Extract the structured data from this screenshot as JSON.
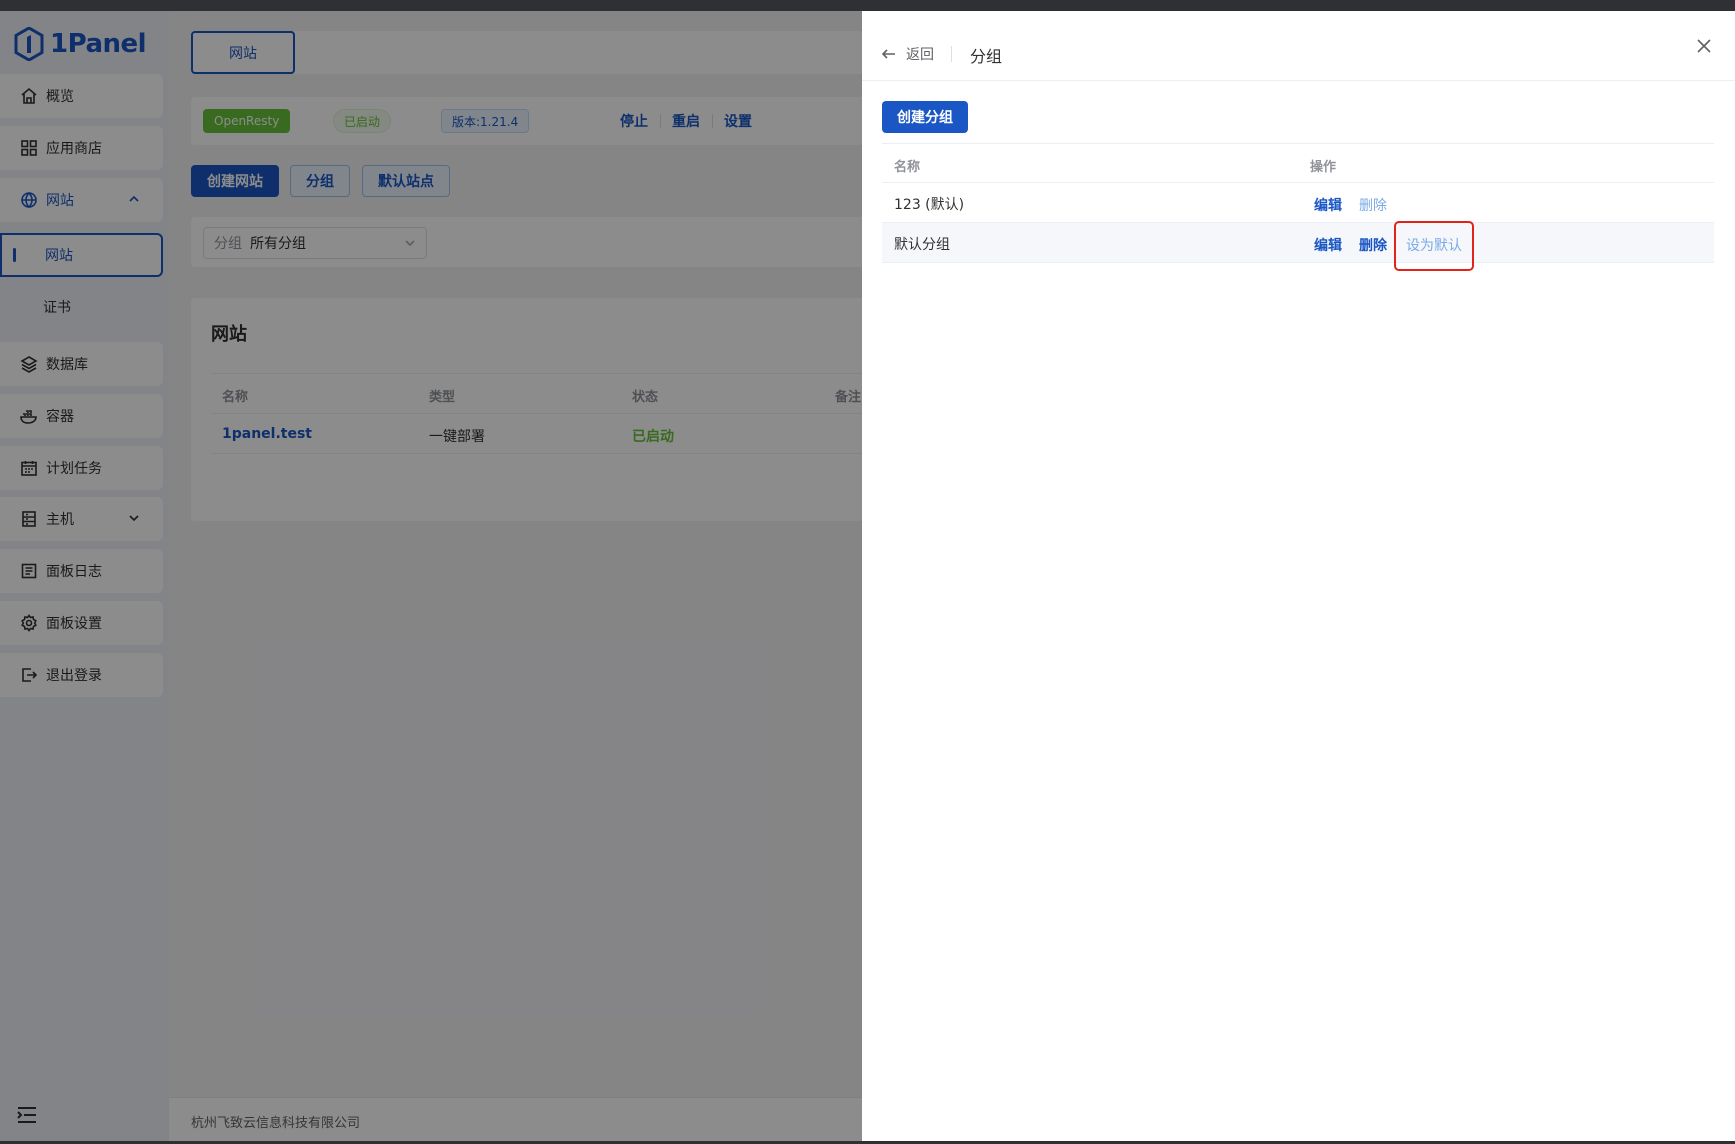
{
  "app": {
    "logo_text": "1Panel",
    "brand_color": "#1a56c4"
  },
  "sidebar": {
    "items": [
      {
        "label": "概览",
        "icon": "home-icon"
      },
      {
        "label": "应用商店",
        "icon": "grid-icon"
      },
      {
        "label": "网站",
        "icon": "globe-icon"
      },
      {
        "label": "数据库",
        "icon": "layers-icon"
      },
      {
        "label": "容器",
        "icon": "docker-icon"
      },
      {
        "label": "计划任务",
        "icon": "calendar-icon"
      },
      {
        "label": "主机",
        "icon": "server-icon"
      },
      {
        "label": "面板日志",
        "icon": "log-icon"
      },
      {
        "label": "面板设置",
        "icon": "gear-icon"
      },
      {
        "label": "退出登录",
        "icon": "logout-icon"
      }
    ],
    "subitems": [
      {
        "label": "网站",
        "active": true
      },
      {
        "label": "证书",
        "active": false
      }
    ]
  },
  "main": {
    "tab": "网站",
    "app_bar": {
      "app_tag": "OpenResty",
      "status_tag": "已启动",
      "version_tag": "版本:1.21.4",
      "actions": [
        "停止",
        "重启",
        "设置"
      ]
    },
    "toolbar": {
      "create_label": "创建网站",
      "group_label": "分组",
      "default_site_label": "默认站点"
    },
    "filter": {
      "prefix": "分组",
      "value": "所有分组"
    },
    "list": {
      "title": "网站",
      "columns": [
        "名称",
        "类型",
        "状态",
        "备注"
      ],
      "rows": [
        {
          "name": "1panel.test",
          "type": "一键部署",
          "status": "已启动"
        }
      ]
    },
    "footer": "杭州飞致云信息科技有限公司"
  },
  "drawer": {
    "back_label": "返回",
    "title": "分组",
    "create_label": "创建分组",
    "columns": {
      "name": "名称",
      "ops": "操作"
    },
    "rows": [
      {
        "name": "123 (默认)",
        "edit": "编辑",
        "delete": "删除"
      },
      {
        "name": "默认分组",
        "edit": "编辑",
        "delete": "删除",
        "set_default": "设为默认"
      }
    ]
  }
}
